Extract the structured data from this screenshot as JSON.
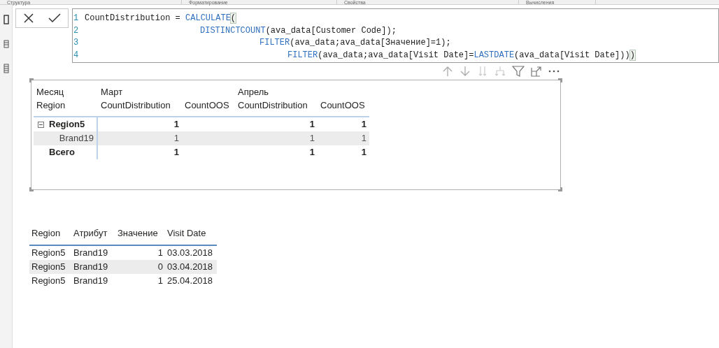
{
  "ribbon_tabs": [
    "Структура",
    "Форматирование",
    "Свойства",
    "Вычисления"
  ],
  "formula_bar": {
    "lines": [
      {
        "number": "1",
        "segments": [
          {
            "kind": "text",
            "text": "CountDistribution = "
          },
          {
            "kind": "keyword",
            "text": "CALCULATE"
          },
          {
            "kind": "bracket",
            "text": "("
          }
        ]
      },
      {
        "number": "2",
        "segments": [
          {
            "kind": "keyword",
            "text": "DISTINCTCOUNT"
          },
          {
            "kind": "text",
            "text": "(ava_data[Customer Code]);"
          }
        ]
      },
      {
        "number": "3",
        "segments": [
          {
            "kind": "keyword",
            "text": "FILTER"
          },
          {
            "kind": "text",
            "text": "(ava_data;ava_data[Значение]=1);"
          }
        ]
      },
      {
        "number": "4",
        "segments": [
          {
            "kind": "keyword",
            "text": "FILTER"
          },
          {
            "kind": "text",
            "text": "(ava_data;ava_data[Visit Date]="
          },
          {
            "kind": "keyword",
            "text": "LASTDATE"
          },
          {
            "kind": "text",
            "text": "(ava_data[Visit Date]))"
          },
          {
            "kind": "bracket",
            "text": ")"
          }
        ]
      }
    ]
  },
  "matrix": {
    "row_headers": [
      "Месяц",
      "Region"
    ],
    "column_groups": [
      {
        "label": "Март",
        "columns": [
          "CountDistribution",
          "CountOOS"
        ]
      },
      {
        "label": "Апрель",
        "columns": [
          "CountDistribution",
          "CountOOS"
        ]
      }
    ],
    "rows": [
      {
        "kind": "group",
        "label": "Region5",
        "expanded": true,
        "selected": false,
        "march_count_distribution": "1",
        "april_count_distribution": "1",
        "april_count_oos": "1"
      },
      {
        "kind": "item",
        "label": "Brand19",
        "selected": true,
        "march_count_distribution": "1",
        "april_count_distribution": "1",
        "april_count_oos": "1"
      },
      {
        "kind": "total",
        "label": "Всего",
        "selected": false,
        "march_count_distribution": "1",
        "april_count_distribution": "1",
        "april_count_oos": "1"
      }
    ]
  },
  "table": {
    "columns": [
      "Region",
      "Атрибут",
      "Значение",
      "Visit Date"
    ],
    "rows": [
      {
        "selected": false,
        "cells": [
          "Region5",
          "Brand19",
          "1",
          "03.03.2018"
        ]
      },
      {
        "selected": true,
        "cells": [
          "Region5",
          "Brand19",
          "0",
          "03.04.2018"
        ]
      },
      {
        "selected": false,
        "cells": [
          "Region5",
          "Brand19",
          "1",
          "25.04.2018"
        ]
      }
    ]
  }
}
